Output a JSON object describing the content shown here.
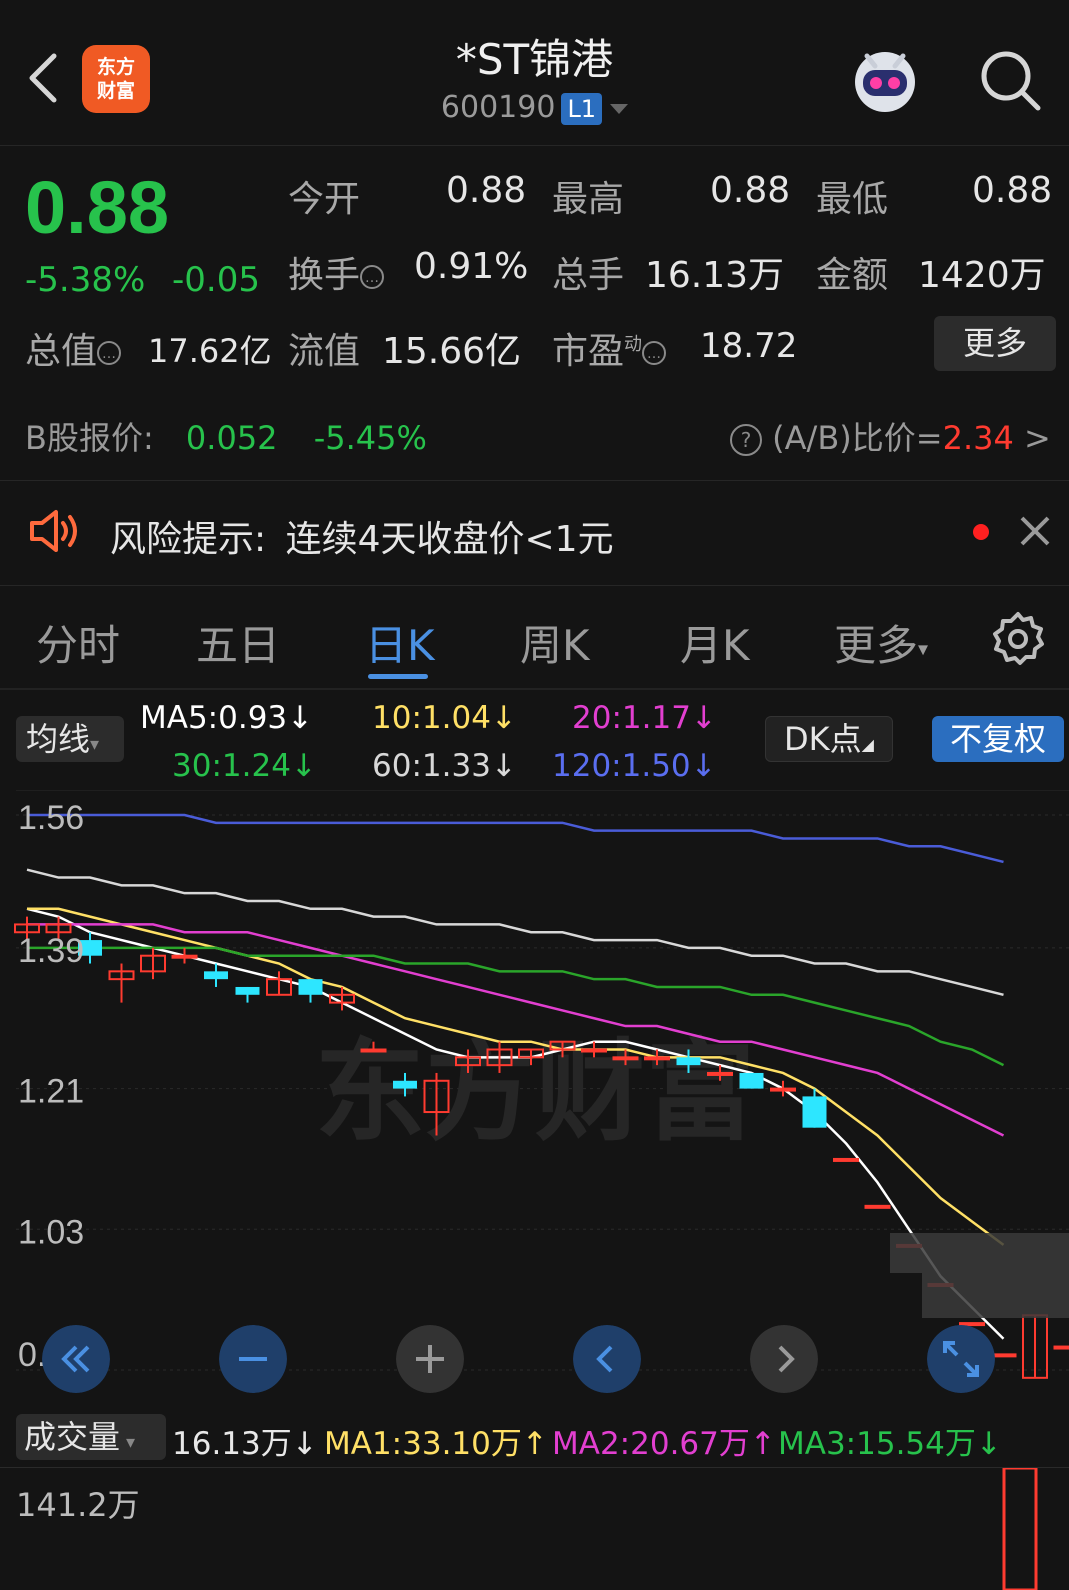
{
  "header": {
    "logo_line1": "东方",
    "logo_line2": "财富",
    "title": "*ST锦港",
    "code": "600190",
    "level_badge": "L1",
    "icons": [
      "back-arrow-icon",
      "robot-assistant-icon",
      "search-icon"
    ]
  },
  "quote": {
    "price": "0.88",
    "change_pct": "-5.38%",
    "change": "-0.05",
    "open_label": "今开",
    "open": "0.88",
    "high_label": "最高",
    "high": "0.88",
    "low_label": "最低",
    "low": "0.88",
    "turnover_label": "换手",
    "turnover": "0.91%",
    "volume_label": "总手",
    "volume": "16.13万",
    "amount_label": "金额",
    "amount": "1420万",
    "mktcap_label": "总值",
    "mktcap": "17.62亿",
    "float_label": "流值",
    "float": "15.66亿",
    "pe_label": "市盈",
    "pe_sup": "动",
    "pe": "18.72",
    "more_label": "更多"
  },
  "bshare": {
    "label": "B股报价:",
    "price": "0.052",
    "change_pct": "-5.45%",
    "ratio_label": "(A/B)比价=",
    "ratio_value": "2.34",
    "ratio_arrow": ">"
  },
  "risk": {
    "label": "风险提示:",
    "text": "连续4天收盘价<1元"
  },
  "tabs": [
    "分时",
    "五日",
    "日K",
    "周K",
    "月K",
    "更多"
  ],
  "active_tab": "日K",
  "ma_legend": {
    "button": "均线",
    "ma5": "MA5:0.93↓",
    "ma10": "10:1.04↓",
    "ma20": "20:1.17↓",
    "ma30": "30:1.24↓",
    "ma60": "60:1.33↓",
    "ma120": "120:1.50↓",
    "dk_button": "DK点",
    "fq_button": "不复权"
  },
  "colors": {
    "up": "#ff3b30",
    "down": "#2de6ff",
    "ma5": "#ffffff",
    "ma10": "#ffe066",
    "ma20": "#e23fd0",
    "ma30": "#2aa52a",
    "ma60": "#d8d8d8",
    "ma120": "#4a5cd8",
    "green_text": "#27c24c",
    "accent_blue": "#4a90e2"
  },
  "chart_data": {
    "type": "candlestick",
    "y_ticks": [
      "1.56",
      "1.39",
      "1.21",
      "1.03",
      "0.85"
    ],
    "ylim": [
      0.85,
      1.56
    ],
    "watermark": "东方财富",
    "candles": [
      {
        "o": 1.41,
        "c": 1.42,
        "h": 1.43,
        "l": 1.4
      },
      {
        "o": 1.41,
        "c": 1.42,
        "h": 1.43,
        "l": 1.4
      },
      {
        "o": 1.4,
        "c": 1.38,
        "h": 1.41,
        "l": 1.37
      },
      {
        "o": 1.35,
        "c": 1.36,
        "h": 1.37,
        "l": 1.32
      },
      {
        "o": 1.36,
        "c": 1.38,
        "h": 1.39,
        "l": 1.35
      },
      {
        "o": 1.38,
        "c": 1.38,
        "h": 1.39,
        "l": 1.37
      },
      {
        "o": 1.36,
        "c": 1.35,
        "h": 1.37,
        "l": 1.34
      },
      {
        "o": 1.34,
        "c": 1.33,
        "h": 1.34,
        "l": 1.32
      },
      {
        "o": 1.33,
        "c": 1.35,
        "h": 1.36,
        "l": 1.33
      },
      {
        "o": 1.35,
        "c": 1.33,
        "h": 1.35,
        "l": 1.32
      },
      {
        "o": 1.32,
        "c": 1.33,
        "h": 1.34,
        "l": 1.31
      },
      {
        "o": 1.26,
        "c": 1.26,
        "h": 1.27,
        "l": 1.26
      },
      {
        "o": 1.22,
        "c": 1.21,
        "h": 1.23,
        "l": 1.2
      },
      {
        "o": 1.18,
        "c": 1.22,
        "h": 1.23,
        "l": 1.15
      },
      {
        "o": 1.24,
        "c": 1.25,
        "h": 1.26,
        "l": 1.23
      },
      {
        "o": 1.24,
        "c": 1.26,
        "h": 1.27,
        "l": 1.23
      },
      {
        "o": 1.25,
        "c": 1.26,
        "h": 1.26,
        "l": 1.24
      },
      {
        "o": 1.26,
        "c": 1.27,
        "h": 1.27,
        "l": 1.25
      },
      {
        "o": 1.26,
        "c": 1.26,
        "h": 1.27,
        "l": 1.25
      },
      {
        "o": 1.25,
        "c": 1.25,
        "h": 1.26,
        "l": 1.24
      },
      {
        "o": 1.25,
        "c": 1.25,
        "h": 1.26,
        "l": 1.24
      },
      {
        "o": 1.25,
        "c": 1.24,
        "h": 1.26,
        "l": 1.23
      },
      {
        "o": 1.23,
        "c": 1.23,
        "h": 1.24,
        "l": 1.22
      },
      {
        "o": 1.23,
        "c": 1.21,
        "h": 1.23,
        "l": 1.21
      },
      {
        "o": 1.21,
        "c": 1.21,
        "h": 1.22,
        "l": 1.2
      },
      {
        "o": 1.2,
        "c": 1.16,
        "h": 1.21,
        "l": 1.16
      },
      {
        "o": 1.12,
        "c": 1.12,
        "h": 1.12,
        "l": 1.12
      },
      {
        "o": 1.06,
        "c": 1.06,
        "h": 1.06,
        "l": 1.06
      },
      {
        "o": 1.01,
        "c": 1.01,
        "h": 1.01,
        "l": 1.01
      },
      {
        "o": 0.96,
        "c": 0.96,
        "h": 0.96,
        "l": 0.96
      },
      {
        "o": 0.91,
        "c": 0.91,
        "h": 0.91,
        "l": 0.91
      },
      {
        "o": 0.87,
        "c": 0.87,
        "h": 0.87,
        "l": 0.87
      },
      {
        "o": 0.84,
        "c": 0.92,
        "h": 0.92,
        "l": 0.84
      },
      {
        "o": 0.88,
        "c": 0.88,
        "h": 0.88,
        "l": 0.88
      }
    ],
    "ma_lines": {
      "ma5": [
        1.44,
        1.43,
        1.41,
        1.4,
        1.39,
        1.38,
        1.37,
        1.36,
        1.35,
        1.34,
        1.32,
        1.3,
        1.28,
        1.26,
        1.25,
        1.25,
        1.25,
        1.26,
        1.27,
        1.27,
        1.26,
        1.25,
        1.24,
        1.23,
        1.21,
        1.18,
        1.14,
        1.09,
        1.03,
        0.97,
        0.93,
        0.89
      ],
      "ma10": [
        1.44,
        1.44,
        1.43,
        1.42,
        1.41,
        1.4,
        1.39,
        1.38,
        1.37,
        1.35,
        1.34,
        1.32,
        1.3,
        1.29,
        1.28,
        1.27,
        1.27,
        1.26,
        1.26,
        1.26,
        1.25,
        1.25,
        1.25,
        1.24,
        1.23,
        1.21,
        1.18,
        1.15,
        1.11,
        1.07,
        1.04,
        1.01
      ],
      "ma20": [
        1.42,
        1.42,
        1.42,
        1.42,
        1.42,
        1.41,
        1.41,
        1.41,
        1.4,
        1.39,
        1.38,
        1.37,
        1.36,
        1.35,
        1.34,
        1.33,
        1.32,
        1.31,
        1.3,
        1.29,
        1.29,
        1.28,
        1.27,
        1.27,
        1.26,
        1.25,
        1.24,
        1.23,
        1.21,
        1.19,
        1.17,
        1.15
      ],
      "ma30": [
        1.39,
        1.39,
        1.39,
        1.39,
        1.39,
        1.39,
        1.39,
        1.38,
        1.38,
        1.38,
        1.38,
        1.38,
        1.37,
        1.37,
        1.37,
        1.36,
        1.36,
        1.36,
        1.35,
        1.35,
        1.34,
        1.34,
        1.34,
        1.33,
        1.33,
        1.32,
        1.31,
        1.3,
        1.29,
        1.27,
        1.26,
        1.24
      ],
      "ma60": [
        1.49,
        1.48,
        1.48,
        1.47,
        1.47,
        1.46,
        1.46,
        1.45,
        1.45,
        1.44,
        1.44,
        1.43,
        1.43,
        1.42,
        1.42,
        1.42,
        1.41,
        1.41,
        1.4,
        1.4,
        1.4,
        1.39,
        1.39,
        1.38,
        1.38,
        1.37,
        1.37,
        1.36,
        1.36,
        1.35,
        1.34,
        1.33
      ],
      "ma120": [
        1.56,
        1.56,
        1.56,
        1.56,
        1.56,
        1.56,
        1.55,
        1.55,
        1.55,
        1.55,
        1.55,
        1.55,
        1.55,
        1.55,
        1.55,
        1.55,
        1.55,
        1.55,
        1.54,
        1.54,
        1.54,
        1.54,
        1.54,
        1.54,
        1.53,
        1.53,
        1.53,
        1.53,
        1.52,
        1.52,
        1.51,
        1.5
      ]
    }
  },
  "volume": {
    "button": "成交量",
    "current": "16.13万↓",
    "ma1": "MA1:33.10万↑",
    "ma2": "MA2:20.67万↑",
    "ma3": "MA3:15.54万↓",
    "max_label": "141.2万",
    "last_bar_fraction": 1.0
  }
}
